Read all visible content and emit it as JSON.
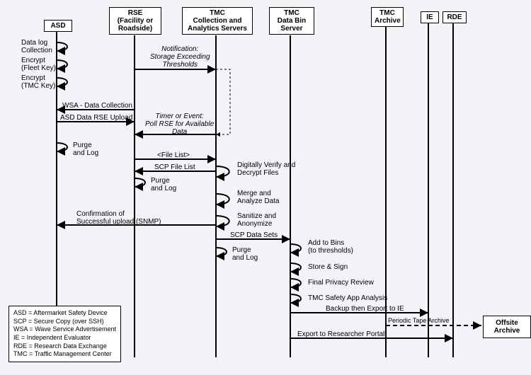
{
  "lanes": {
    "asd": {
      "title": "ASD"
    },
    "rse": {
      "title": "RSE\n(Facility or\nRoadside)"
    },
    "tmc_ca": {
      "title": "TMC\nCollection and\nAnalytics Servers"
    },
    "tmc_bin": {
      "title": "TMC\nData Bin\nServer"
    },
    "tmc_arch": {
      "title": "TMC\nArchive"
    },
    "ie": {
      "title": "IE"
    },
    "rde": {
      "title": "RDE"
    }
  },
  "self_actions": {
    "asd_datalog": "Data log\nCollection",
    "asd_enc_fleet": "Encrypt\n(Fleet Key)",
    "asd_enc_tmc": "Encrypt\n(TMC Key)",
    "asd_purge": "Purge\nand Log",
    "rse_purge": "Purge\nand Log",
    "tmc_verify": "Digitally Verify and\nDecrypt Files",
    "tmc_merge": "Merge and\nAnalyze Data",
    "tmc_sanitize": "Sanitize and\nAnonymize",
    "tmc_purge": "Purge\nand Log",
    "bin_add": "Add to Bins\n(to thresholds)",
    "bin_store": "Store & Sign",
    "bin_review": "Final Privacy Review",
    "bin_safety": "TMC Safety App Analysis"
  },
  "messages": {
    "notif": "Notification:\nStorage Exceeding\nThresholds",
    "wsa": "WSA - Data Collection",
    "asd_upload": "ASD Data RSE Upload",
    "poll": "Timer or Event:\nPoll RSE for Available\nData",
    "filelist": "<File List>",
    "scp_filelist": "SCP File List",
    "confirm": "Confirmation of\nSuccessful upload (SNMP)",
    "scp_datasets": "SCP Data Sets",
    "backup_ie": "Backup then Export to IE",
    "tape": "Periodic Tape Archive",
    "export_portal": "Export to Researcher Portal"
  },
  "legend": {
    "asd": "ASD = Aftermarket Safety Device",
    "scp": "SCP = Secure Copy (over SSH)",
    "wsa": "WSA = Wave Service Advertisement",
    "ie": "IE = Independent Evaluator",
    "rde": "RDE = Research Data Exchange",
    "tmc": "TMC = Traffic Management Center"
  },
  "offsite": "Offsite\nArchive"
}
